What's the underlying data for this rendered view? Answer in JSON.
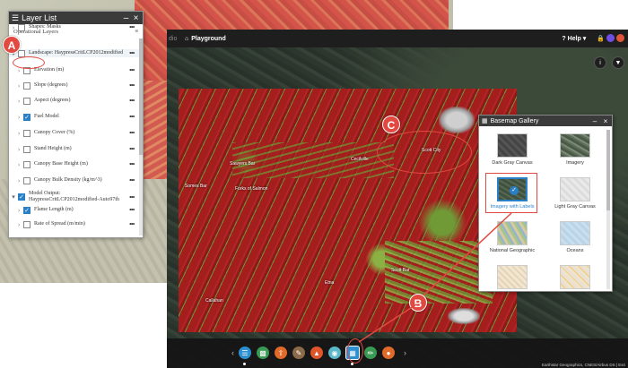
{
  "layer_list": {
    "title": "Layer List",
    "subtitle": "Operational Layers",
    "layers": [
      {
        "label": "Shapes: Masks",
        "checked": false,
        "expanded": false
      },
      {
        "label": "Landscape: HaypressCritLCP2012modified",
        "checked": false,
        "expanded": true
      },
      {
        "label": "Elevation (m)",
        "checked": false,
        "expanded": false
      },
      {
        "label": "Slope (degrees)",
        "checked": false,
        "expanded": false
      },
      {
        "label": "Aspect (degrees)",
        "checked": false,
        "expanded": false
      },
      {
        "label": "Fuel Model",
        "checked": true,
        "expanded": false
      },
      {
        "label": "Canopy Cover (%)",
        "checked": false,
        "expanded": false
      },
      {
        "label": "Stand Height (m)",
        "checked": false,
        "expanded": false
      },
      {
        "label": "Canopy Base Height (m)",
        "checked": false,
        "expanded": false
      },
      {
        "label": "Canopy Bulk Density (kg/m^3)",
        "checked": false,
        "expanded": false
      },
      {
        "label": "Model Output: HaypressCritLCP2012modified-Auto97th",
        "checked": true,
        "expanded": true
      },
      {
        "label": "Flame Length (m)",
        "checked": true,
        "expanded": false
      },
      {
        "label": "Rate of Spread (m/min)",
        "checked": false,
        "expanded": false
      }
    ]
  },
  "topbar": {
    "tab": "dio",
    "title": "Playground",
    "help": "Help",
    "help_caret": "▾"
  },
  "map_labels": {
    "somes_bar": "Somes Bar",
    "forks": "Forks of Salmon",
    "sawyers": "Sawyers Bar",
    "cecilville": "Cecilville",
    "scott": "Scott Bar",
    "callahan": "Callahan",
    "etna": "Etna",
    "town1": "Happy Camp",
    "town2": "Yreka",
    "town3": "Fort Jones",
    "city": "Scott City"
  },
  "basemap_gallery": {
    "title": "Basemap Gallery",
    "items": [
      {
        "label": "Dark Gray Canvas",
        "thumb": "dark"
      },
      {
        "label": "Imagery",
        "thumb": "img"
      },
      {
        "label": "Imagery with Labels",
        "thumb": "imgl",
        "selected": true
      },
      {
        "label": "Light Gray Canvas",
        "thumb": "lgray"
      },
      {
        "label": "National Geographic",
        "thumb": "natgeo"
      },
      {
        "label": "Oceans",
        "thumb": "oceans"
      },
      {
        "label": "OpenStreetMap",
        "thumb": "osm"
      },
      {
        "label": "Streets",
        "thumb": "streets"
      }
    ]
  },
  "toolbar": {
    "buttons": [
      {
        "icon": "layers-icon",
        "color": "#2c8fcf"
      },
      {
        "icon": "legend-icon",
        "color": "#3a9a54"
      },
      {
        "icon": "upload-icon",
        "color": "#e06a2a"
      },
      {
        "icon": "measure-icon",
        "color": "#8a6a48"
      },
      {
        "icon": "fire-icon",
        "color": "#e0552a"
      },
      {
        "icon": "location-icon",
        "color": "#5bb8c9"
      },
      {
        "icon": "basemap-icon",
        "color": "#2c8fcf",
        "active": true
      },
      {
        "icon": "draw-icon",
        "color": "#3a9a54"
      },
      {
        "icon": "palette-icon",
        "color": "#e06a2a"
      }
    ]
  },
  "attribution": "Earthstar Geographics, CNES/Airbus DS | Esri",
  "annotations": {
    "a": "A",
    "b": "B",
    "c": "C"
  },
  "colors": {
    "accent": "#e24a41",
    "selected": "#2a7fc9",
    "panel_header": "#3b3b3b"
  }
}
